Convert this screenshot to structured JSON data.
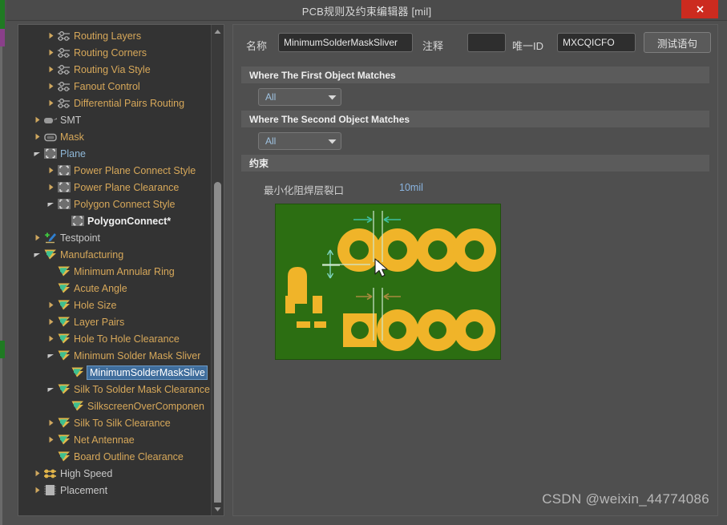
{
  "window": {
    "title": "PCB规则及约束编辑器 [mil]",
    "close_icon": "close-icon"
  },
  "tree": {
    "items": [
      {
        "label": "Routing Layers",
        "indent": 2,
        "arrow": "collapsed",
        "icon": "routing-icon",
        "color": "orange"
      },
      {
        "label": "Routing Corners",
        "indent": 2,
        "arrow": "collapsed",
        "icon": "routing-icon",
        "color": "orange"
      },
      {
        "label": "Routing Via Style",
        "indent": 2,
        "arrow": "collapsed",
        "icon": "routing-icon",
        "color": "orange"
      },
      {
        "label": "Fanout Control",
        "indent": 2,
        "arrow": "collapsed",
        "icon": "routing-icon",
        "color": "orange"
      },
      {
        "label": "Differential Pairs Routing",
        "indent": 2,
        "arrow": "collapsed",
        "icon": "routing-icon",
        "color": "orange"
      },
      {
        "label": "SMT",
        "indent": 1,
        "arrow": "collapsed",
        "icon": "smt-icon",
        "color": "gray"
      },
      {
        "label": "Mask",
        "indent": 1,
        "arrow": "collapsed",
        "icon": "mask-icon",
        "color": "orange"
      },
      {
        "label": "Plane",
        "indent": 1,
        "arrow": "expanded",
        "icon": "plane-icon",
        "color": "blue"
      },
      {
        "label": "Power Plane Connect Style",
        "indent": 2,
        "arrow": "collapsed",
        "icon": "plane-icon",
        "color": "orange"
      },
      {
        "label": "Power Plane Clearance",
        "indent": 2,
        "arrow": "collapsed",
        "icon": "plane-icon",
        "color": "orange"
      },
      {
        "label": "Polygon Connect Style",
        "indent": 2,
        "arrow": "expanded",
        "icon": "plane-icon",
        "color": "orange"
      },
      {
        "label": "PolygonConnect*",
        "indent": 3,
        "arrow": "none",
        "icon": "plane-icon",
        "color": "white"
      },
      {
        "label": "Testpoint",
        "indent": 1,
        "arrow": "collapsed",
        "icon": "testpoint-icon",
        "color": "gray"
      },
      {
        "label": "Manufacturing",
        "indent": 1,
        "arrow": "expanded",
        "icon": "flag-icon",
        "color": "orange"
      },
      {
        "label": "Minimum Annular Ring",
        "indent": 2,
        "arrow": "none",
        "icon": "flag-icon",
        "color": "orange"
      },
      {
        "label": "Acute Angle",
        "indent": 2,
        "arrow": "none",
        "icon": "flag-icon",
        "color": "orange"
      },
      {
        "label": "Hole Size",
        "indent": 2,
        "arrow": "collapsed",
        "icon": "flag-icon",
        "color": "orange"
      },
      {
        "label": "Layer Pairs",
        "indent": 2,
        "arrow": "collapsed",
        "icon": "flag-icon",
        "color": "orange"
      },
      {
        "label": "Hole To Hole Clearance",
        "indent": 2,
        "arrow": "collapsed",
        "icon": "flag-icon",
        "color": "orange"
      },
      {
        "label": "Minimum Solder Mask Sliver",
        "indent": 2,
        "arrow": "expanded",
        "icon": "flag-icon",
        "color": "orange"
      },
      {
        "label": "MinimumSolderMaskSlive",
        "indent": 3,
        "arrow": "none",
        "icon": "flag-icon",
        "color": "orange",
        "selected": true
      },
      {
        "label": "Silk To Solder Mask Clearance",
        "indent": 2,
        "arrow": "expanded",
        "icon": "flag-icon",
        "color": "orange"
      },
      {
        "label": "SilkscreenOverComponen",
        "indent": 3,
        "arrow": "none",
        "icon": "flag-icon",
        "color": "orange"
      },
      {
        "label": "Silk To Silk Clearance",
        "indent": 2,
        "arrow": "collapsed",
        "icon": "flag-icon",
        "color": "orange"
      },
      {
        "label": "Net Antennae",
        "indent": 2,
        "arrow": "collapsed",
        "icon": "flag-icon",
        "color": "orange"
      },
      {
        "label": "Board Outline Clearance",
        "indent": 2,
        "arrow": "none",
        "icon": "flag-icon",
        "color": "orange"
      },
      {
        "label": "High Speed",
        "indent": 1,
        "arrow": "collapsed",
        "icon": "highspeed-icon",
        "color": "gray"
      },
      {
        "label": "Placement",
        "indent": 1,
        "arrow": "collapsed",
        "icon": "placement-icon",
        "color": "gray"
      }
    ],
    "scrollbar": {
      "up_icon": "scroll-up-icon",
      "down_icon": "scroll-down-icon"
    }
  },
  "header": {
    "name_label": "名称",
    "name_value": "MinimumSolderMaskSliver",
    "comment_label": "注释",
    "comment_value": "",
    "uid_label": "唯一ID",
    "uid_value": "MXCQICFO",
    "test_button": "测试语句"
  },
  "sections": {
    "first_match_title": "Where The First Object Matches",
    "first_match_value": "All",
    "second_match_title": "Where The Second Object Matches",
    "second_match_value": "All",
    "constraint_title": "约束",
    "constraint_label": "最小化阻焊层裂口",
    "constraint_value": "10mil"
  },
  "figure": {
    "name": "pcb-solder-mask-sliver-diagram",
    "board_color": "#2c6e12",
    "pad_color": "#f0b429",
    "dim_color_top": "#7fd4c0",
    "dim_color_bottom": "#b08a3a"
  },
  "watermark": "CSDN @weixin_44774086"
}
